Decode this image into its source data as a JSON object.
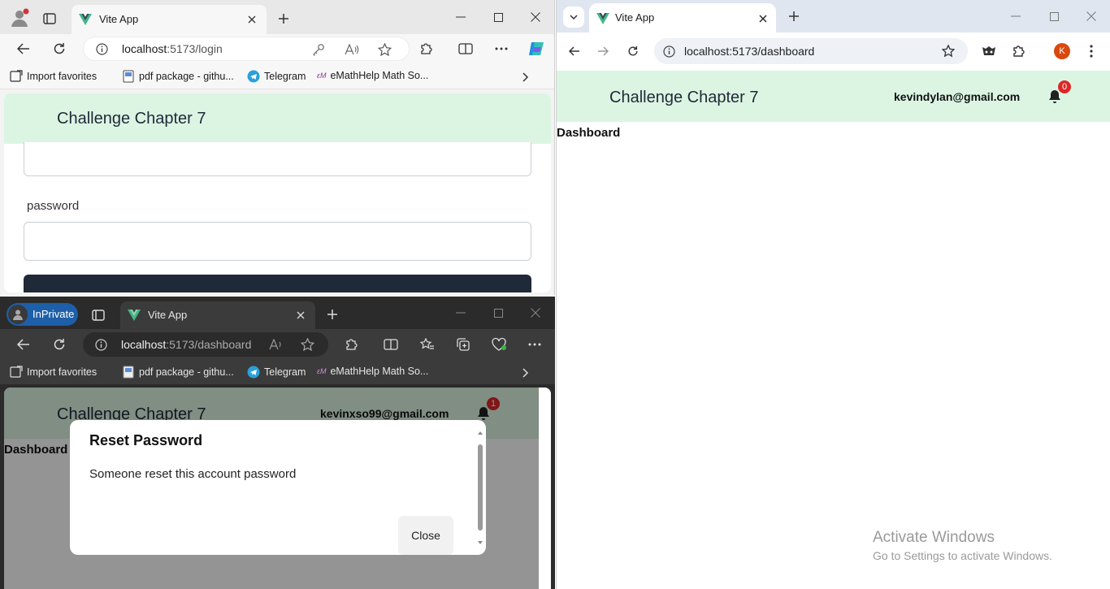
{
  "edge_window": {
    "tab_title": "Vite App",
    "url_host": "localhost",
    "url_path": ":5173/login",
    "favorites": [
      "Import favorites",
      "pdf package - githu...",
      "Telegram",
      "eMathHelp Math So..."
    ],
    "app_title": "Challenge Chapter 7",
    "password_label": "password"
  },
  "inprivate_window": {
    "badge": "InPrivate",
    "tab_title": "Vite App",
    "url_host": "localhost",
    "url_path": ":5173/dashboard",
    "favorites": [
      "Import favorites",
      "pdf package - githu...",
      "Telegram",
      "eMathHelp Math So..."
    ],
    "app_title": "Challenge Chapter 7",
    "user_email": "kevinxso99@gmail.com",
    "notification_count": "1",
    "dashboard_label": "Dashboard",
    "modal": {
      "title": "Reset Password",
      "message": "Someone reset this account password",
      "close_label": "Close"
    }
  },
  "chrome_window": {
    "tab_title": "Vite App",
    "url": "localhost:5173/dashboard",
    "profile_initial": "K",
    "app_title": "Challenge Chapter 7",
    "user_email": "kevindylan@gmail.com",
    "notification_count": "0",
    "dashboard_label": "Dashboard"
  },
  "watermark": {
    "title": "Activate Windows",
    "subtitle": "Go to Settings to activate Windows."
  },
  "colors": {
    "header_green": "#dcf5e3",
    "badge_red": "#dc2626",
    "inprivate_blue": "#1d5fa8",
    "dark_button": "#1f2937"
  }
}
